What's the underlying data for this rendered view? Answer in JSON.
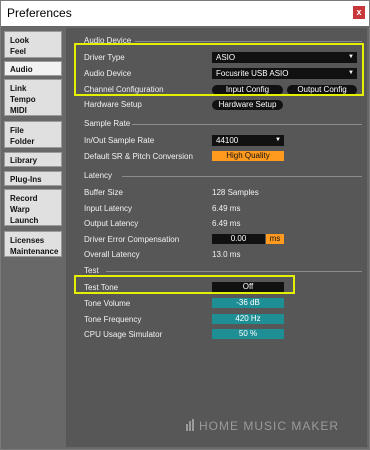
{
  "window": {
    "title": "Preferences",
    "close_label": "x"
  },
  "nav": {
    "groups": [
      {
        "lines": [
          "Look",
          "Feel"
        ]
      },
      {
        "lines": [
          "Audio"
        ]
      },
      {
        "lines": [
          "Link",
          "Tempo",
          "MIDI"
        ]
      },
      {
        "lines": [
          "File",
          "Folder"
        ]
      },
      {
        "lines": [
          "Library"
        ]
      },
      {
        "lines": [
          "Plug-Ins"
        ]
      },
      {
        "lines": [
          "Record",
          "Warp",
          "Launch"
        ]
      },
      {
        "lines": [
          "Licenses",
          "Maintenance"
        ]
      }
    ]
  },
  "audio_device": {
    "section": "Audio Device",
    "driver_type_label": "Driver Type",
    "driver_type_value": "ASIO",
    "audio_device_label": "Audio Device",
    "audio_device_value": "Focusrite USB ASIO",
    "channel_config_label": "Channel Configuration",
    "input_config_btn": "Input Config",
    "output_config_btn": "Output Config",
    "hardware_setup_label": "Hardware Setup",
    "hardware_setup_btn": "Hardware Setup"
  },
  "sample_rate": {
    "section": "Sample Rate",
    "in_out_label": "In/Out Sample Rate",
    "in_out_value": "44100",
    "default_sr_label": "Default SR & Pitch Conversion",
    "default_sr_value": "High Quality"
  },
  "latency": {
    "section": "Latency",
    "buffer_size_label": "Buffer Size",
    "buffer_size_value": "128 Samples",
    "input_latency_label": "Input Latency",
    "input_latency_value": "6.49 ms",
    "output_latency_label": "Output Latency",
    "output_latency_value": "6.49 ms",
    "driver_error_label": "Driver Error Compensation",
    "driver_error_value": "0.00",
    "driver_error_unit": "ms",
    "overall_latency_label": "Overall Latency",
    "overall_latency_value": "13.0 ms"
  },
  "test": {
    "section": "Test",
    "test_tone_label": "Test Tone",
    "test_tone_value": "Off",
    "tone_volume_label": "Tone Volume",
    "tone_volume_value": "-36 dB",
    "tone_frequency_label": "Tone Frequency",
    "tone_frequency_value": "420 Hz",
    "cpu_sim_label": "CPU Usage Simulator",
    "cpu_sim_value": "50 %"
  },
  "watermark": "HOME MUSIC MAKER",
  "colors": {
    "highlight": "#e5f000",
    "accent_orange": "#ff9a1f",
    "accent_teal": "#1f8f96",
    "panel_bg": "#575757"
  }
}
